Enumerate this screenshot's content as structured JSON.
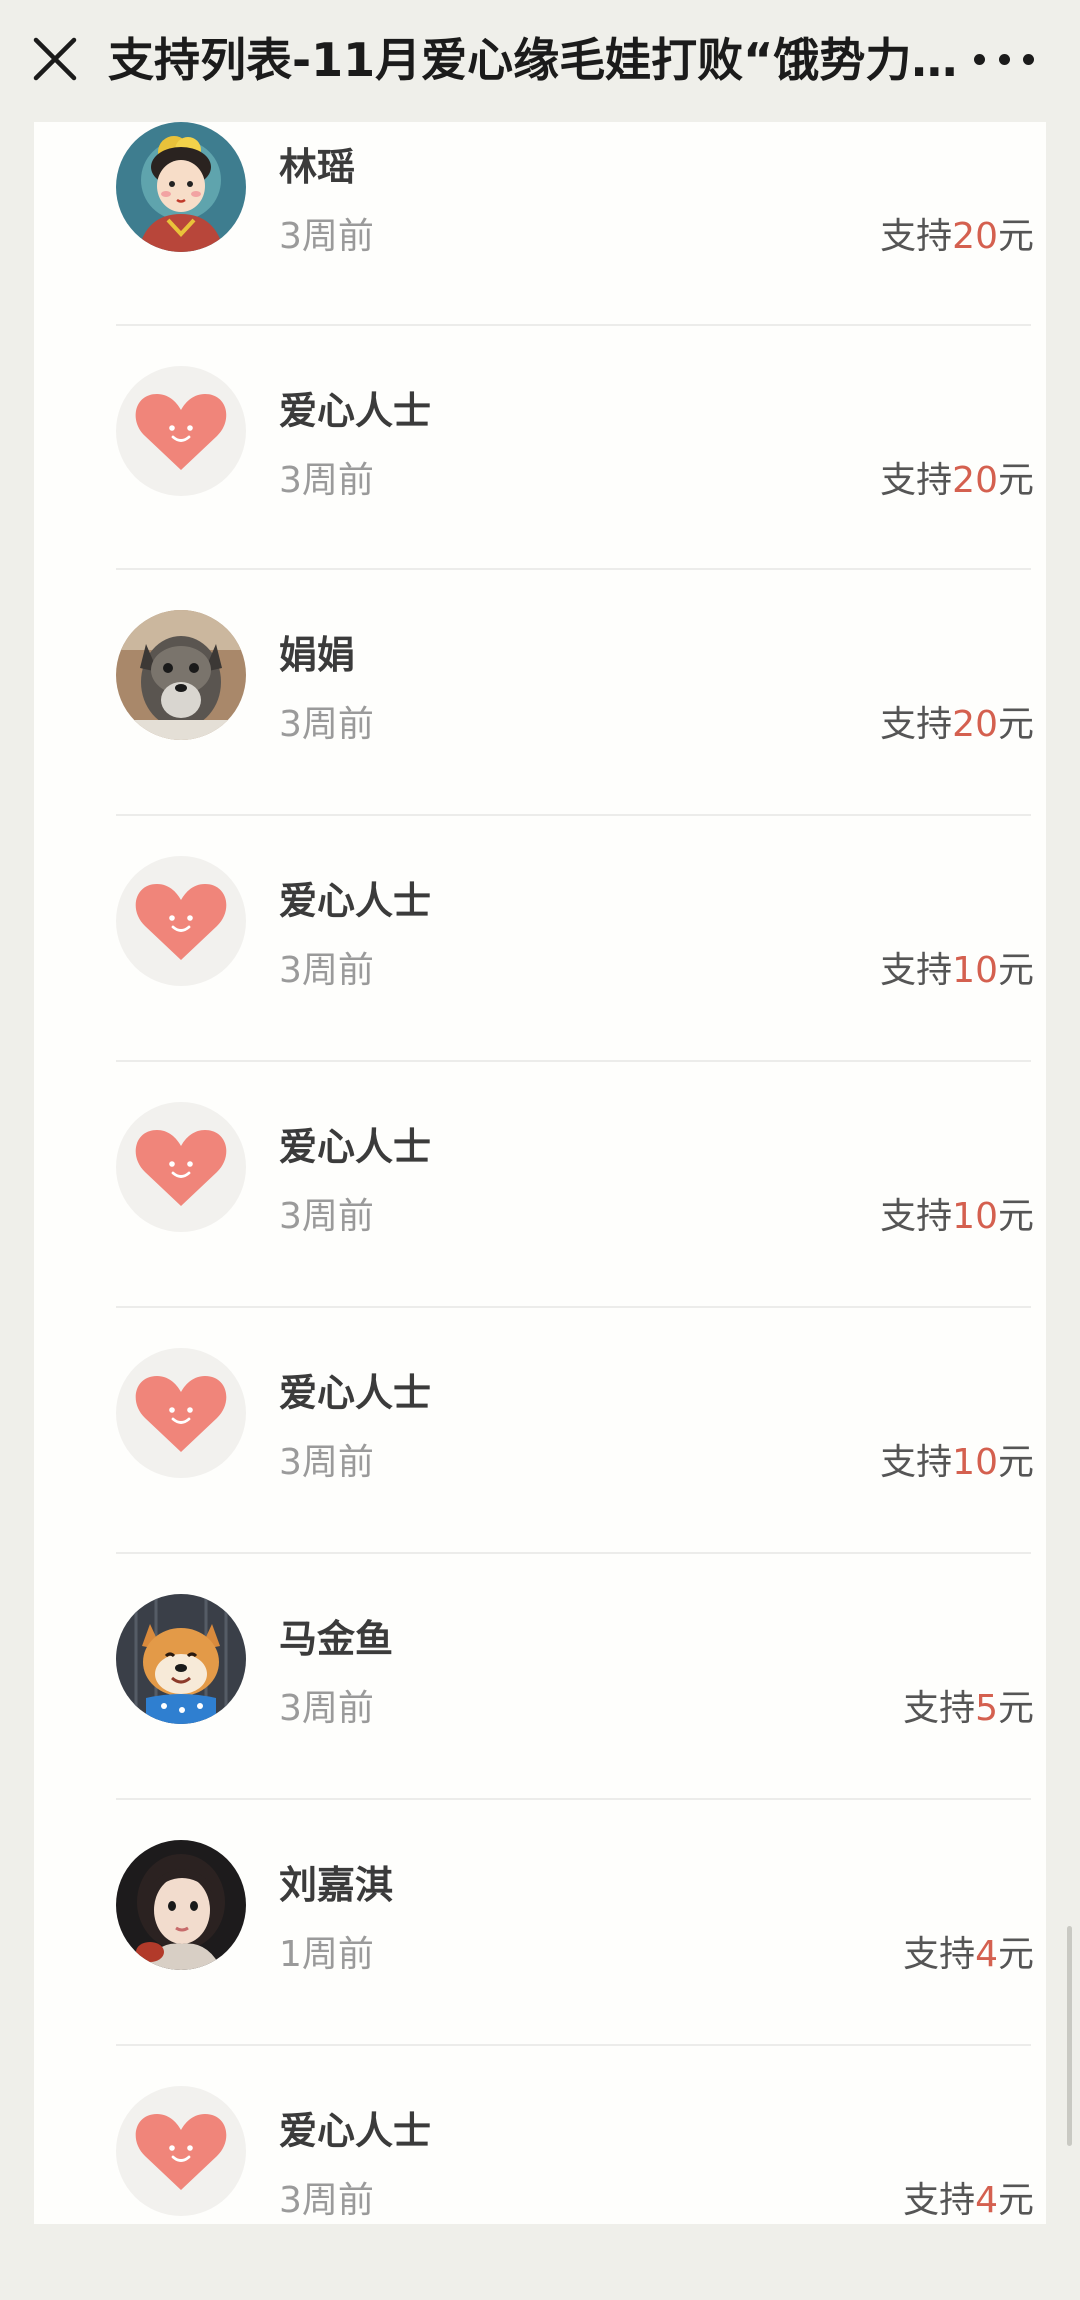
{
  "header": {
    "title": "支持列表-11月爱心缘毛娃打败“饿势力”行...",
    "close_icon": "close-icon",
    "more_icon": "more-horizontal-icon"
  },
  "colors": {
    "amount_number": "#d4604f",
    "heart": "#f0857a",
    "background": "#efefea"
  },
  "supporters": [
    {
      "name": "林瑶",
      "time": "3周前",
      "amount_prefix": "支持",
      "amount": "20",
      "amount_unit": "元",
      "avatar": "cartoon-girl-avatar"
    },
    {
      "name": "爱心人士",
      "time": "3周前",
      "amount_prefix": "支持",
      "amount": "20",
      "amount_unit": "元",
      "avatar": "heart-smile-icon"
    },
    {
      "name": "娟娟",
      "time": "3周前",
      "amount_prefix": "支持",
      "amount": "20",
      "amount_unit": "元",
      "avatar": "dog-photo-avatar"
    },
    {
      "name": "爱心人士",
      "time": "3周前",
      "amount_prefix": "支持",
      "amount": "10",
      "amount_unit": "元",
      "avatar": "heart-smile-icon"
    },
    {
      "name": "爱心人士",
      "time": "3周前",
      "amount_prefix": "支持",
      "amount": "10",
      "amount_unit": "元",
      "avatar": "heart-smile-icon"
    },
    {
      "name": "爱心人士",
      "time": "3周前",
      "amount_prefix": "支持",
      "amount": "10",
      "amount_unit": "元",
      "avatar": "heart-smile-icon"
    },
    {
      "name": "马金鱼",
      "time": "3周前",
      "amount_prefix": "支持",
      "amount": "5",
      "amount_unit": "元",
      "avatar": "shiba-photo-avatar"
    },
    {
      "name": "刘嘉淇",
      "time": "1周前",
      "amount_prefix": "支持",
      "amount": "4",
      "amount_unit": "元",
      "avatar": "girl-photo-avatar"
    },
    {
      "name": "爱心人士",
      "time": "3周前",
      "amount_prefix": "支持",
      "amount": "4",
      "amount_unit": "元",
      "avatar": "heart-smile-icon"
    }
  ]
}
